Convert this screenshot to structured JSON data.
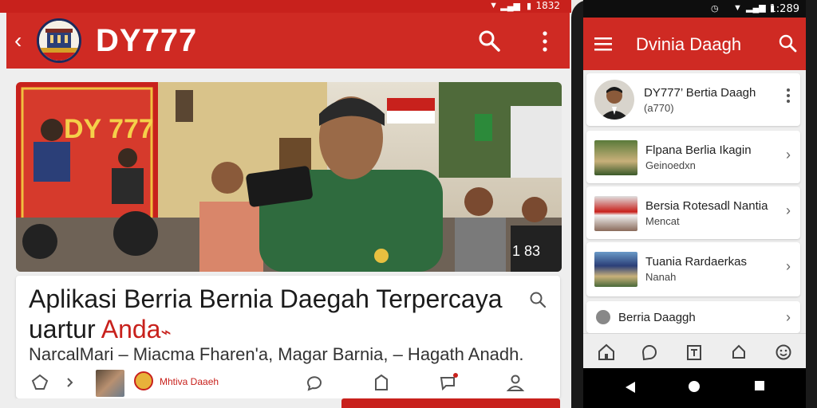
{
  "left": {
    "status_time": "1832",
    "app_title": "DY777",
    "hero_banner_text": "DY 777",
    "hero_overlay_number": "1 83",
    "headline_line1": "Aplikasi Berria Bernia Daegah Terpercaya",
    "headline_line2_prefix": "uartur ",
    "headline_line2_accent": "Anda",
    "subtitle": "NarcalMari – Miacma Fharen'a, Magar Barnia, – Hagath Anadh.",
    "source_label": "Mhtiva Daaeh",
    "icons": [
      "back-arrow-icon",
      "search-icon",
      "more-vert-icon",
      "share-icon",
      "chevron-right-icon",
      "comment-icon",
      "bookmark-icon",
      "send-icon",
      "profile-icon"
    ]
  },
  "right": {
    "status_time": "1:289",
    "app_title": "Dvinia Daagh",
    "profile": {
      "name": "DY777’ Bertia Daagh",
      "handle": "(a770)"
    },
    "items": [
      {
        "title": "Flpana Berlia Ikagin",
        "subtitle": "Geinoedxn"
      },
      {
        "title": "Bersia Rotesadl Nantia",
        "subtitle": "Mencat"
      },
      {
        "title": "Tuania Rardaerkas",
        "subtitle": "Nanah"
      },
      {
        "title": "Berria Daaggh",
        "subtitle": ""
      }
    ],
    "nav_icons": [
      "home-icon",
      "chat-icon",
      "article-icon",
      "notification-icon",
      "emoji-icon"
    ]
  },
  "colors": {
    "brand_red": "#cf2a23",
    "status_red": "#c8211c",
    "background": "#eeeeee"
  }
}
